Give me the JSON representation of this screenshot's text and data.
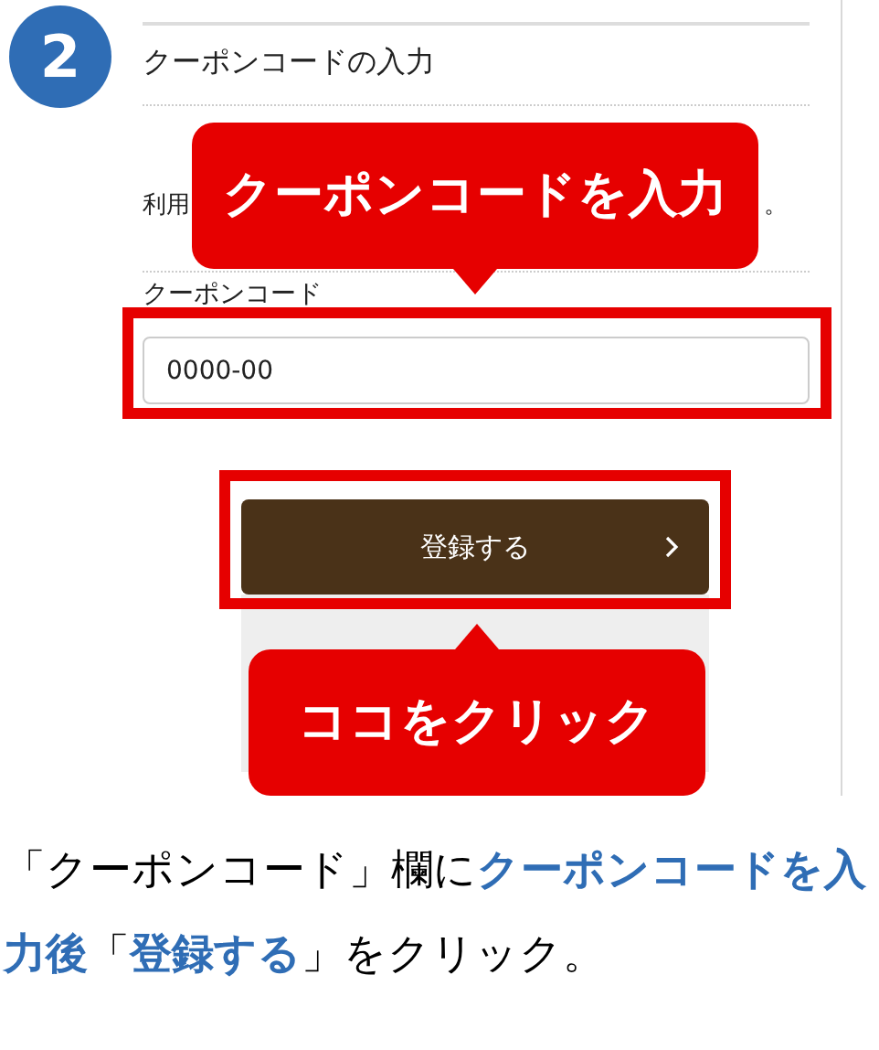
{
  "step": {
    "number": "2"
  },
  "form": {
    "title": "クーポンコードの入力",
    "note_start": "利用",
    "note_end": "。",
    "field_label": "クーポンコード",
    "coupon_field": {
      "value": "0000-00"
    },
    "submit_button": {
      "label": "登録する"
    }
  },
  "callouts": [
    {
      "text": "クーポンコードを入力",
      "kind": "below"
    },
    {
      "text": "ココをクリック",
      "kind": "above"
    }
  ],
  "caption": [
    {
      "text": "「クーポンコード」欄に",
      "kind": "plain"
    },
    {
      "text": "クーポンコードを入力後",
      "kind": "highlight"
    },
    {
      "text": "「",
      "kind": "plain"
    },
    {
      "text": "登録する",
      "kind": "highlight"
    },
    {
      "text": "」をクリック。",
      "kind": "plain"
    }
  ]
}
